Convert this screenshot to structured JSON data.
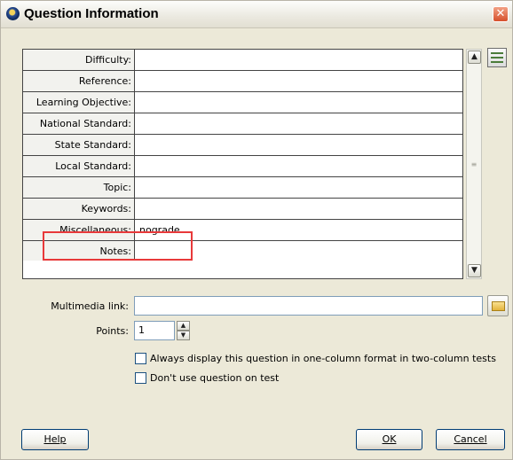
{
  "window": {
    "title": "Question Information",
    "close_glyph": "✕"
  },
  "grid": {
    "rows": [
      {
        "label": "Difficulty:",
        "value": ""
      },
      {
        "label": "Reference:",
        "value": ""
      },
      {
        "label": "Learning Objective:",
        "value": ""
      },
      {
        "label": "National Standard:",
        "value": ""
      },
      {
        "label": "State Standard:",
        "value": ""
      },
      {
        "label": "Local Standard:",
        "value": ""
      },
      {
        "label": "Topic:",
        "value": ""
      },
      {
        "label": "Keywords:",
        "value": ""
      },
      {
        "label": "Miscellaneous:",
        "value": "nograde"
      },
      {
        "label": "Notes:",
        "value": ""
      }
    ]
  },
  "multimedia": {
    "label": "Multimedia link:",
    "value": ""
  },
  "points": {
    "label": "Points:",
    "value": "1"
  },
  "options": {
    "one_column": "Always display this question in one-column format in two-column tests",
    "dont_use": "Don't use question on test"
  },
  "buttons": {
    "help": "Help",
    "ok": "OK",
    "cancel": "Cancel"
  },
  "colors": {
    "highlight": "#e8393a",
    "dialog_bg": "#ece9d8"
  }
}
